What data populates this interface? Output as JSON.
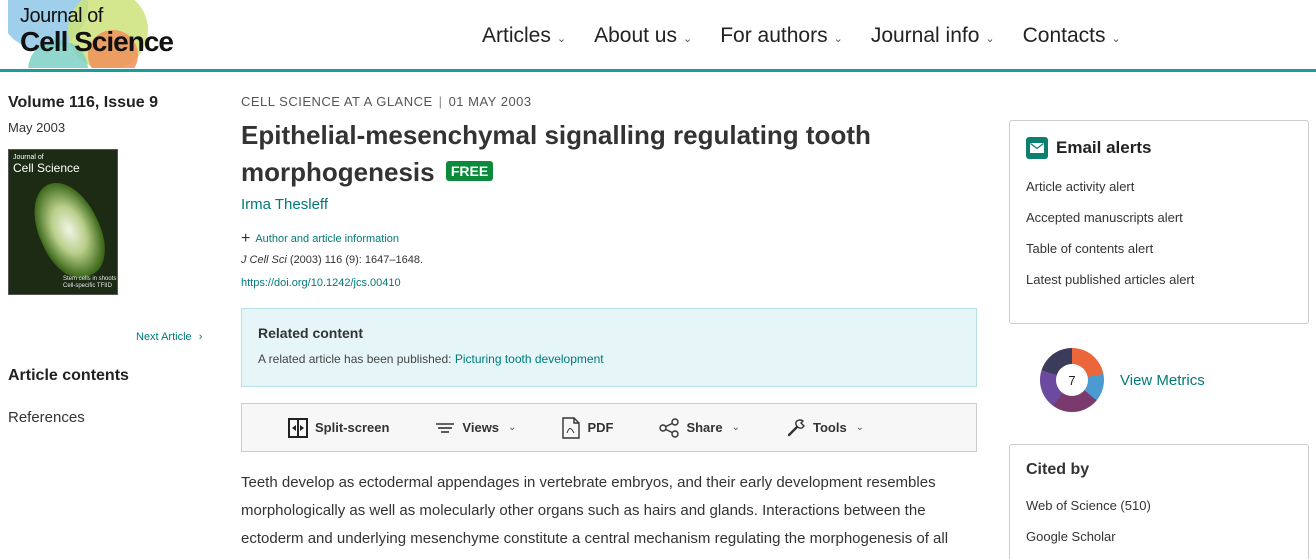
{
  "header": {
    "logo_line1": "Journal of",
    "logo_line2": "Cell Science",
    "nav": [
      {
        "label": "Articles"
      },
      {
        "label": "About us"
      },
      {
        "label": "For authors"
      },
      {
        "label": "Journal info"
      },
      {
        "label": "Contacts"
      }
    ]
  },
  "sidebar": {
    "volume": "Volume 116, Issue 9",
    "date": "May 2003",
    "cover": {
      "title_small": "Journal of",
      "title": "Cell Science",
      "footer_line1": "Stem cells in shoots",
      "footer_line2": "Cell-specific TFIID"
    },
    "next_article": "Next Article",
    "contents_title": "Article contents",
    "contents_items": [
      {
        "label": "References"
      }
    ]
  },
  "article": {
    "category": "CELL SCIENCE AT A GLANCE",
    "date": "01 MAY 2003",
    "title_line1": "Epithelial-mesenchymal signalling regulating tooth",
    "title_line2": "morphogenesis",
    "badge": "FREE",
    "author": "Irma Thesleff",
    "author_info": "Author and article information",
    "citation_journal": "J Cell Sci",
    "citation_rest": " (2003) 116 (9): 1647–1648.",
    "doi": "https://doi.org/10.1242/jcs.00410",
    "related": {
      "title": "Related content",
      "text": "A related article has been published: ",
      "link": "Picturing tooth development"
    },
    "toolbar": {
      "split": "Split-screen",
      "views": "Views",
      "pdf": "PDF",
      "share": "Share",
      "tools": "Tools"
    },
    "body": [
      "Teeth develop as ectodermal appendages in vertebrate embryos, and their early development resembles",
      "morphologically as well as molecularly other organs such as hairs and glands. Interactions between the",
      "ectoderm and underlying mesenchyme constitute a central mechanism regulating the morphogenesis of all"
    ]
  },
  "right": {
    "email_title": "Email alerts",
    "email_items": [
      {
        "label": "Article activity alert"
      },
      {
        "label": "Accepted manuscripts alert"
      },
      {
        "label": "Table of contents alert"
      },
      {
        "label": "Latest published articles alert"
      }
    ],
    "metrics_score": "7",
    "view_metrics": "View Metrics",
    "cited_title": "Cited by",
    "cited_items": [
      {
        "label": "Web of Science (510)"
      },
      {
        "label": "Google Scholar"
      }
    ]
  },
  "colors": {
    "accent": "#007a78",
    "header_rule": "#1a9c98",
    "free_badge": "#0a8a3a",
    "related_bg": "#e6f6f8"
  },
  "icons": [
    "logo-graphic",
    "chevron-down-icon",
    "split-screen-icon",
    "views-icon",
    "pdf-icon",
    "share-icon",
    "tools-icon",
    "plus-icon",
    "email-icon",
    "altmetric-donut",
    "chevron-right-icon"
  ]
}
